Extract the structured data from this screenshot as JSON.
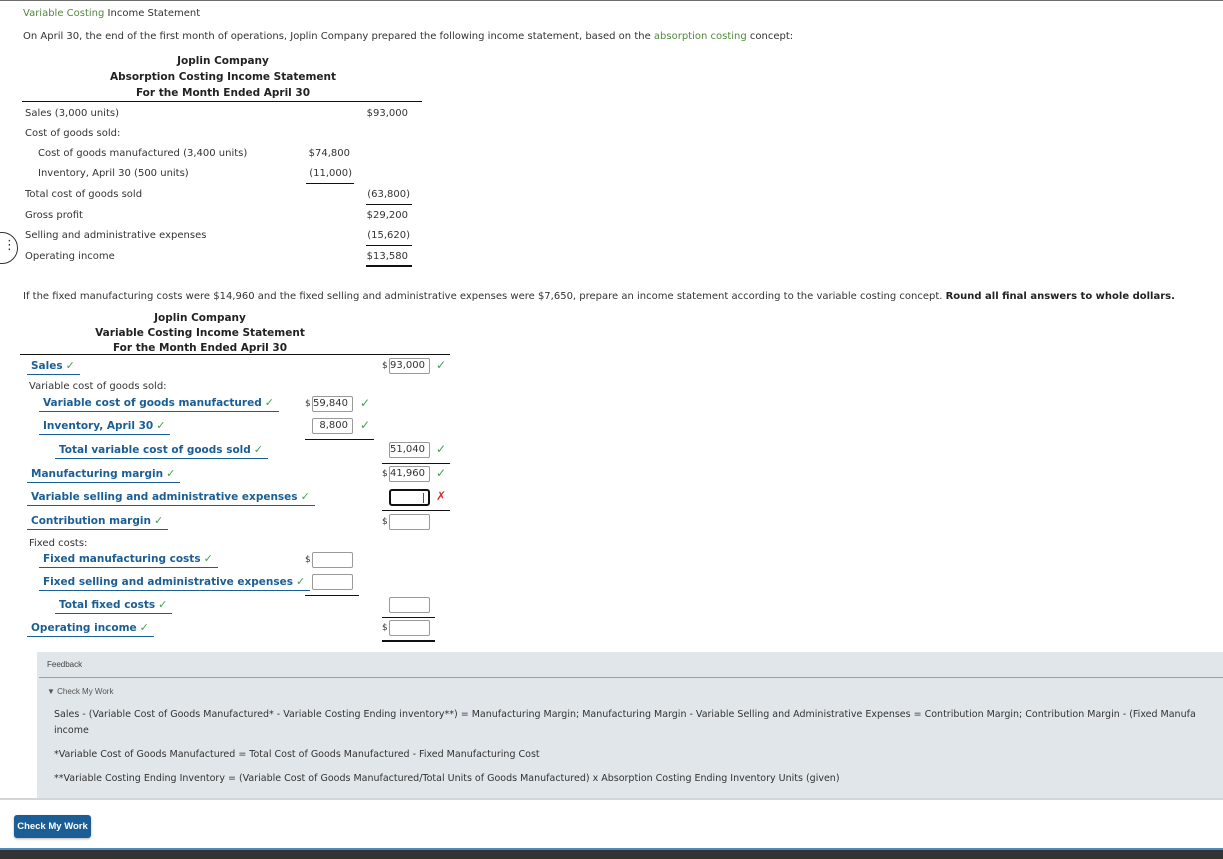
{
  "title": {
    "link": "Variable Costing",
    "rest": " Income Statement"
  },
  "intro": {
    "before": "On April 30, the end of the first month of operations, Joplin Company prepared the following income statement, based on the ",
    "link": "absorption costing",
    "after": " concept:"
  },
  "absorption": {
    "company": "Joplin Company",
    "statement": "Absorption Costing Income Statement",
    "period": "For the Month Ended April 30",
    "rows": [
      {
        "label": "Sales (3,000 units)",
        "col1": "",
        "col2": "$93,000"
      },
      {
        "label": "Cost of goods sold:",
        "col1": "",
        "col2": ""
      },
      {
        "label": "Cost of goods manufactured (3,400 units)",
        "col1": "$74,800",
        "col2": ""
      },
      {
        "label": "Inventory, April 30 (500 units)",
        "col1": "(11,000)",
        "col2": ""
      },
      {
        "label": "Total cost of goods sold",
        "col1": "",
        "col2": "(63,800)"
      },
      {
        "label": "Gross profit",
        "col1": "",
        "col2": "$29,200"
      },
      {
        "label": "Selling and administrative expenses",
        "col1": "",
        "col2": "(15,620)"
      },
      {
        "label": "Operating income",
        "col1": "",
        "col2": "$13,580"
      }
    ]
  },
  "instruction": {
    "text": "If the fixed manufacturing costs were $14,960 and the fixed selling and administrative expenses were $7,650, prepare an income statement according to the variable costing concept. ",
    "bold": "Round all final answers to whole dollars."
  },
  "variable": {
    "company": "Joplin Company",
    "statement": "Variable Costing Income Statement",
    "period": "For the Month Ended April 30",
    "currency": "$",
    "check": "✓",
    "cross": "✗",
    "sales": {
      "label": "Sales",
      "value": "93,000"
    },
    "vcogs_heading": "Variable cost of goods sold:",
    "vcgm": {
      "label": "Variable cost of goods manufactured",
      "value": "59,840"
    },
    "inventory": {
      "label": "Inventory, April 30",
      "value": "8,800"
    },
    "total_vcogs": {
      "label": "Total variable cost of goods sold",
      "value": "51,040"
    },
    "mfg_margin": {
      "label": "Manufacturing margin",
      "value": "41,960"
    },
    "var_sa": {
      "label": "Variable selling and administrative expenses",
      "value": ""
    },
    "contrib_margin": {
      "label": "Contribution margin",
      "value": ""
    },
    "fixed_heading": "Fixed costs:",
    "fixed_mfg": {
      "label": "Fixed manufacturing costs",
      "value": ""
    },
    "fixed_sa": {
      "label": "Fixed selling and administrative expenses",
      "value": ""
    },
    "total_fixed": {
      "label": "Total fixed costs",
      "value": ""
    },
    "op_income": {
      "label": "Operating income",
      "value": ""
    }
  },
  "feedback": {
    "title": "Feedback",
    "toggle": "▼ Check My Work",
    "line1": "Sales - (Variable Cost of Goods Manufactured* - Variable Costing Ending inventory**) = Manufacturing Margin; Manufacturing Margin - Variable Selling and Administrative Expenses = Contribution Margin; Contribution Margin - (Fixed Manufa",
    "line1b": "income",
    "line2": "*Variable Cost of Goods Manufactured = Total Cost of Goods Manufactured - Fixed Manufacturing Cost",
    "line3": "**Variable Costing Ending Inventory = (Variable Cost of Goods Manufactured/Total Units of Goods Manufactured) x Absorption Costing Ending Inventory Units (given)"
  },
  "button": {
    "check_my_work": "Check My Work"
  }
}
